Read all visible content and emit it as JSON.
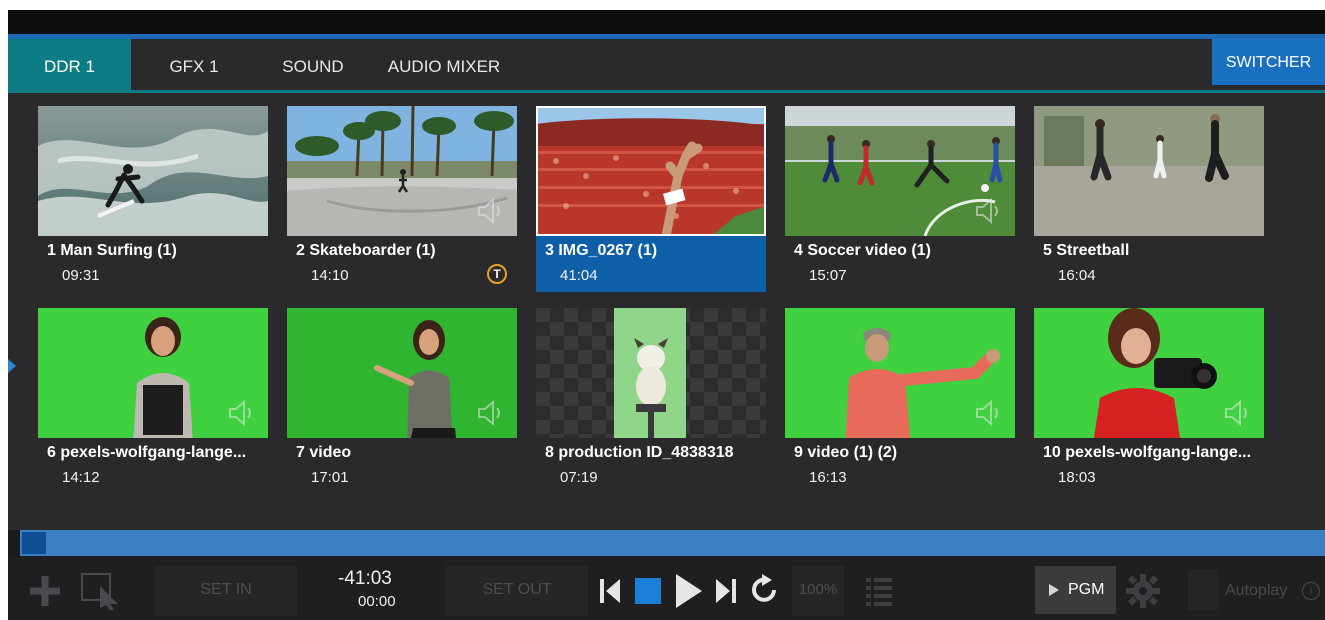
{
  "tabs": [
    {
      "label": "DDR 1",
      "active": true
    },
    {
      "label": "GFX 1",
      "active": false
    },
    {
      "label": "SOUND",
      "active": false
    },
    {
      "label": "AUDIO MIXER",
      "active": false
    }
  ],
  "switcher_label": "SWITCHER",
  "clips": [
    {
      "title": "1 Man Surfing (1)",
      "duration": "09:31"
    },
    {
      "title": "2 Skateboarder (1)",
      "duration": "14:10",
      "badge": "T"
    },
    {
      "title": "3 IMG_0267 (1)",
      "duration": "41:04",
      "selected": true
    },
    {
      "title": "4 Soccer video (1)",
      "duration": "15:07"
    },
    {
      "title": "5 Streetball",
      "duration": "16:04"
    },
    {
      "title": "6 pexels-wolfgang-lange...",
      "duration": "14:12"
    },
    {
      "title": "7 video",
      "duration": "17:01"
    },
    {
      "title": "8 production ID_4838318",
      "duration": "07:19"
    },
    {
      "title": "9 video (1) (2)",
      "duration": "16:13"
    },
    {
      "title": "10 pexels-wolfgang-lange...",
      "duration": "18:03"
    }
  ],
  "transport": {
    "set_in": "SET IN",
    "set_out": "SET OUT",
    "time_remaining": "-41:03",
    "time_elapsed": "00:00",
    "speed": "100%",
    "pgm": "PGM",
    "autoplay": "Autoplay"
  },
  "colors": {
    "accent_teal": "#0d7d85",
    "accent_blue": "#1a6fc0",
    "selected_caption": "#0f5ea8",
    "badge_ring": "#e8a21a",
    "green_screen": "#3fd13f"
  },
  "icons": [
    "add-icon",
    "select-icon",
    "skip-back-icon",
    "stop-icon",
    "play-icon",
    "skip-forward-icon",
    "loop-icon",
    "playlist-icon",
    "play-small-icon",
    "gear-icon",
    "audio-icon",
    "info-icon"
  ]
}
